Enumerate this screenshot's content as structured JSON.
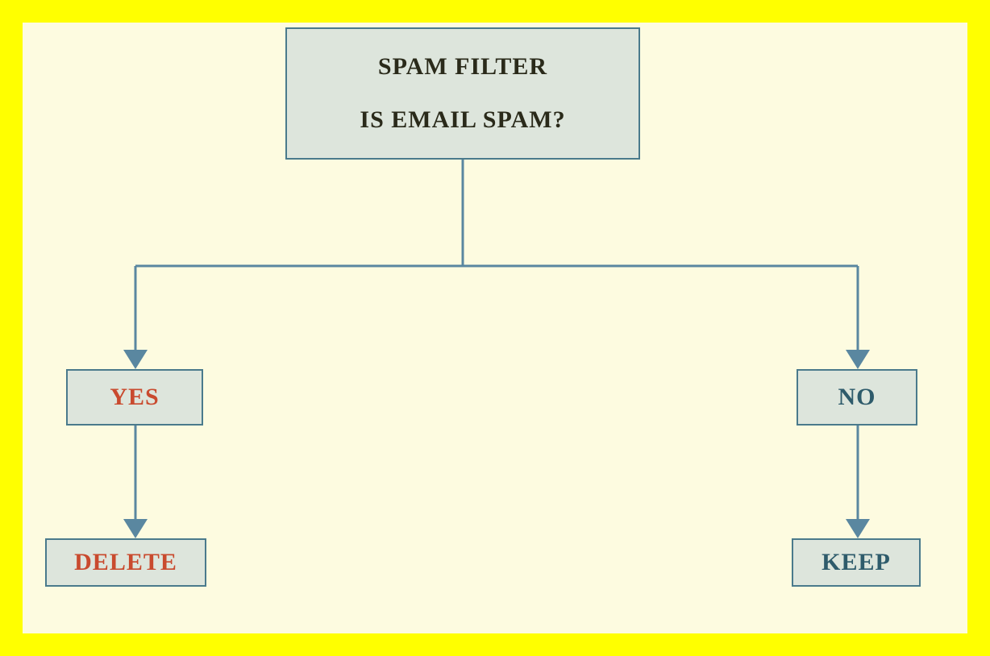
{
  "diagram": {
    "root": {
      "line1": "SPAM FILTER",
      "line2": "IS EMAIL SPAM?"
    },
    "branches": {
      "yes": {
        "label": "YES",
        "action": "DELETE"
      },
      "no": {
        "label": "NO",
        "action": "KEEP"
      }
    }
  },
  "colors": {
    "frame": "#ffff00",
    "canvas": "#fdfbe0",
    "nodeFill": "#dde5dc",
    "nodeBorder": "#4a7a8c",
    "arrow": "#5a87a0",
    "textDark": "#2a2a1a",
    "textRed": "#c94a2e",
    "textTeal": "#2e5b6b"
  }
}
